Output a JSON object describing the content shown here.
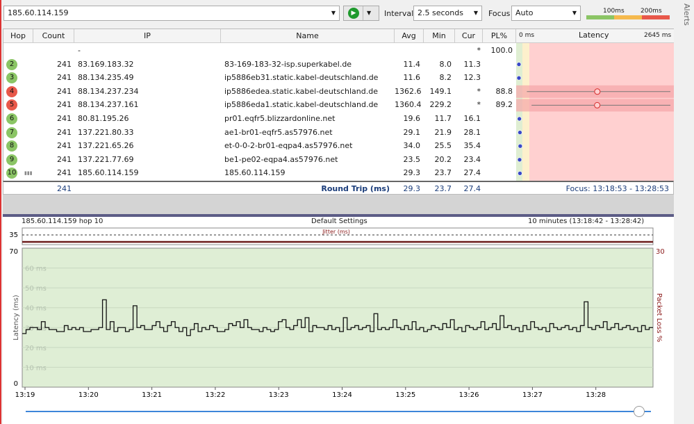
{
  "toolbar": {
    "target": "185.60.114.159",
    "interval_label": "Interval",
    "interval_value": "2.5 seconds",
    "focus_label": "Focus",
    "focus_value": "Auto",
    "legend_100": "100ms",
    "legend_200": "200ms",
    "play_icon": "play-icon"
  },
  "alerts_label": "Alerts",
  "columns": {
    "hop": "Hop",
    "count": "Count",
    "ip": "IP",
    "name": "Name",
    "avg": "Avg",
    "min": "Min",
    "cur": "Cur",
    "pl": "PL%",
    "latency_min": "0 ms",
    "latency": "Latency",
    "latency_max": "2645 ms"
  },
  "hops": [
    {
      "hop": "",
      "count": "",
      "ip": "-",
      "name": "",
      "avg": "",
      "min": "",
      "cur": "*",
      "pl": "100.0",
      "status": "none"
    },
    {
      "hop": "2",
      "count": "241",
      "ip": "83.169.183.32",
      "name": "83-169-183-32-isp.superkabel.de",
      "avg": "11.4",
      "min": "8.0",
      "cur": "11.3",
      "pl": "",
      "status": "good"
    },
    {
      "hop": "3",
      "count": "241",
      "ip": "88.134.235.49",
      "name": "ip5886eb31.static.kabel-deutschland.de",
      "avg": "11.6",
      "min": "8.2",
      "cur": "12.3",
      "pl": "",
      "status": "good"
    },
    {
      "hop": "4",
      "count": "241",
      "ip": "88.134.237.234",
      "name": "ip5886edea.static.kabel-deutschland.de",
      "avg": "1362.6",
      "min": "149.1",
      "cur": "*",
      "pl": "88.8",
      "status": "bad"
    },
    {
      "hop": "5",
      "count": "241",
      "ip": "88.134.237.161",
      "name": "ip5886eda1.static.kabel-deutschland.de",
      "avg": "1360.4",
      "min": "229.2",
      "cur": "*",
      "pl": "89.2",
      "status": "bad"
    },
    {
      "hop": "6",
      "count": "241",
      "ip": "80.81.195.26",
      "name": "pr01.eqfr5.blizzardonline.net",
      "avg": "19.6",
      "min": "11.7",
      "cur": "16.1",
      "pl": "",
      "status": "good"
    },
    {
      "hop": "7",
      "count": "241",
      "ip": "137.221.80.33",
      "name": "ae1-br01-eqfr5.as57976.net",
      "avg": "29.1",
      "min": "21.9",
      "cur": "28.1",
      "pl": "",
      "status": "good"
    },
    {
      "hop": "8",
      "count": "241",
      "ip": "137.221.65.26",
      "name": "et-0-0-2-br01-eqpa4.as57976.net",
      "avg": "34.0",
      "min": "25.5",
      "cur": "35.4",
      "pl": "",
      "status": "good"
    },
    {
      "hop": "9",
      "count": "241",
      "ip": "137.221.77.69",
      "name": "be1-pe02-eqpa4.as57976.net",
      "avg": "23.5",
      "min": "20.2",
      "cur": "23.4",
      "pl": "",
      "status": "good"
    },
    {
      "hop": "10",
      "count": "241",
      "ip": "185.60.114.159",
      "name": "185.60.114.159",
      "avg": "29.3",
      "min": "23.7",
      "cur": "27.4",
      "pl": "",
      "status": "good"
    }
  ],
  "summary": {
    "count": "241",
    "label": "Round Trip (ms)",
    "avg": "29.3",
    "min": "23.7",
    "cur": "27.4",
    "focus": "Focus: 13:18:53 - 13:28:53"
  },
  "graph": {
    "target": "185.60.114.159 hop 10",
    "settings": "Default Settings",
    "range": "10 minutes (13:18:42 - 13:28:42)",
    "jitter_label": "Jitter (ms)",
    "jitter_max": "35",
    "ylabel": "Latency (ms)",
    "y2label": "Packet Loss %",
    "y_max": "70",
    "y_min": "0",
    "y2_max": "30",
    "grid_labels": [
      "10 ms",
      "20 ms",
      "30 ms",
      "40 ms",
      "50 ms",
      "60 ms"
    ]
  },
  "chart_data": {
    "type": "line",
    "ylim": [
      0,
      70
    ],
    "y2lim": [
      0,
      30
    ],
    "grid": true,
    "x_ticks": [
      "13:19",
      "13:20",
      "13:21",
      "13:22",
      "13:23",
      "13:24",
      "13:25",
      "13:26",
      "13:27",
      "13:28"
    ],
    "latency_ms": [
      27,
      29,
      30,
      30,
      29,
      33,
      30,
      29,
      29,
      28,
      28,
      31,
      29,
      30,
      29,
      30,
      28,
      28,
      29,
      29,
      30,
      44,
      29,
      33,
      28,
      30,
      30,
      28,
      29,
      41,
      30,
      31,
      29,
      29,
      31,
      33,
      30,
      28,
      31,
      33,
      30,
      28,
      30,
      26,
      29,
      32,
      28,
      30,
      29,
      31,
      30,
      28,
      28,
      29,
      32,
      31,
      33,
      30,
      34,
      30,
      29,
      29,
      28,
      30,
      29,
      28,
      29,
      33,
      34,
      30,
      29,
      31,
      34,
      30,
      35,
      28,
      31,
      30,
      30,
      29,
      31,
      29,
      30,
      28,
      35,
      29,
      30,
      31,
      29,
      30,
      31,
      28,
      37,
      29,
      30,
      29,
      30,
      34,
      30,
      29,
      31,
      29,
      33,
      29,
      30,
      28,
      29,
      31,
      30,
      29,
      32,
      30,
      34,
      29,
      30,
      28,
      31,
      30,
      29,
      30,
      33,
      29,
      30,
      32,
      29,
      36,
      30,
      31,
      29,
      30,
      28,
      31,
      29,
      33,
      30,
      29,
      30,
      28,
      32,
      30,
      29,
      30,
      31,
      29,
      30,
      28,
      31,
      43,
      30,
      29,
      31,
      30,
      33,
      29,
      30,
      32,
      29,
      30,
      31,
      29,
      30,
      28,
      31,
      29,
      30
    ]
  }
}
